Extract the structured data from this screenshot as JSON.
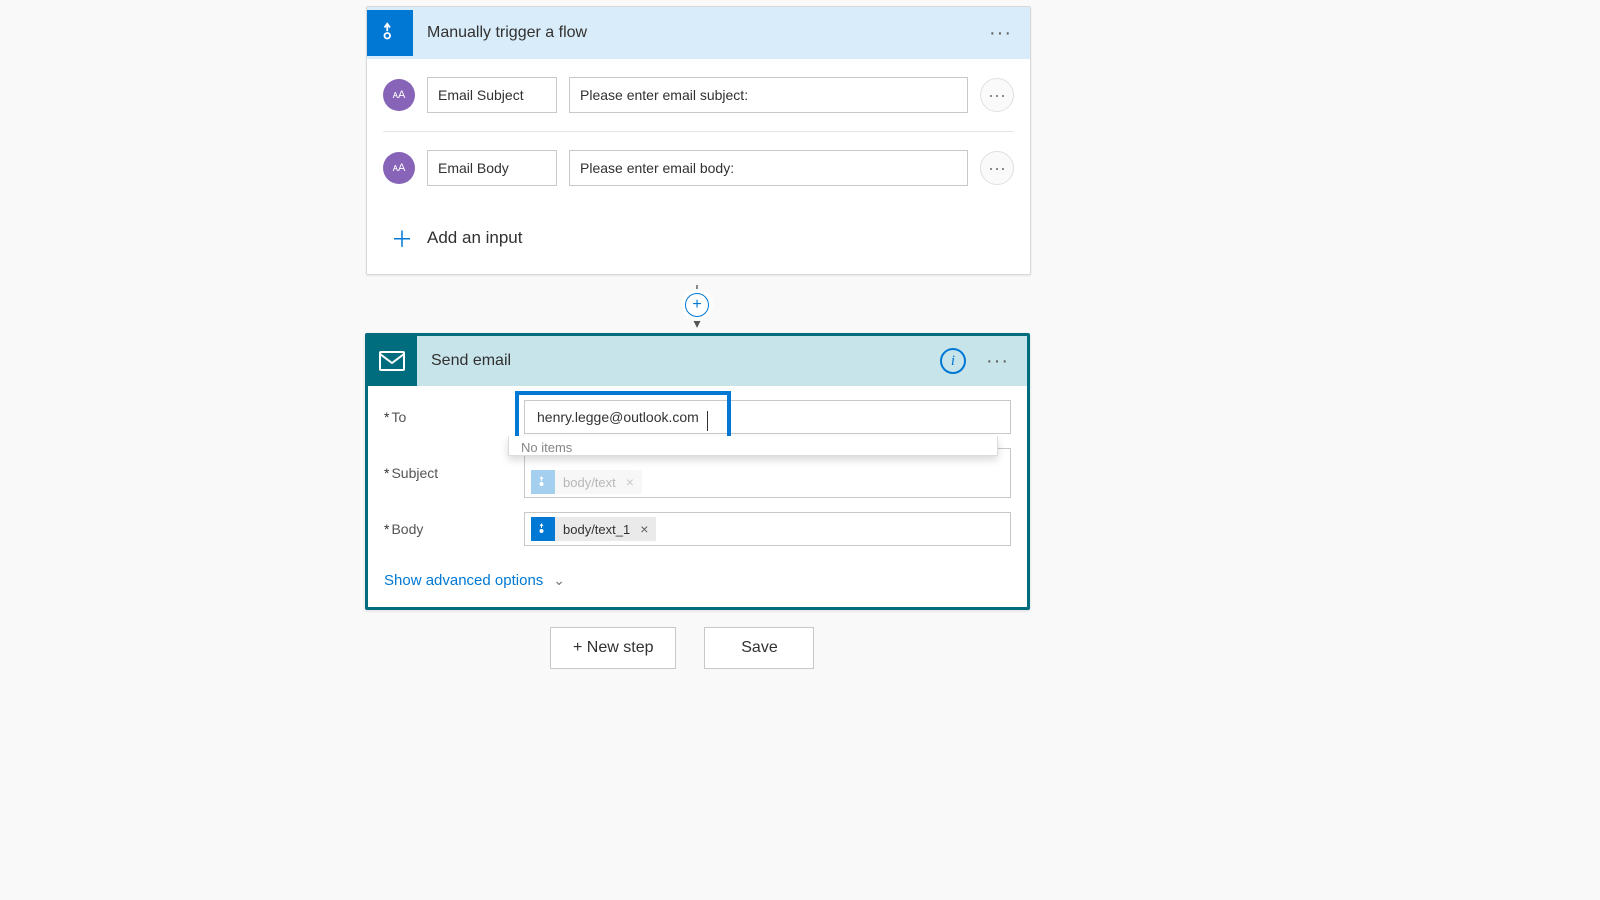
{
  "trigger": {
    "title": "Manually trigger a flow",
    "inputs": [
      {
        "name": "Email Subject",
        "prompt": "Please enter email subject:"
      },
      {
        "name": "Email Body",
        "prompt": "Please enter email body:"
      }
    ],
    "add_input_label": "Add an input"
  },
  "email": {
    "title": "Send email",
    "fields": {
      "to_label": "To",
      "to_value": "henry.legge@outlook.com",
      "subject_label": "Subject",
      "subject_token": "body/text",
      "body_label": "Body",
      "body_token": "body/text_1"
    },
    "dropdown_text": "No items",
    "advanced_label": "Show advanced options"
  },
  "buttons": {
    "new_step": "+ New step",
    "save": "Save"
  },
  "glyphs": {
    "param_icon": "ᴀA"
  }
}
